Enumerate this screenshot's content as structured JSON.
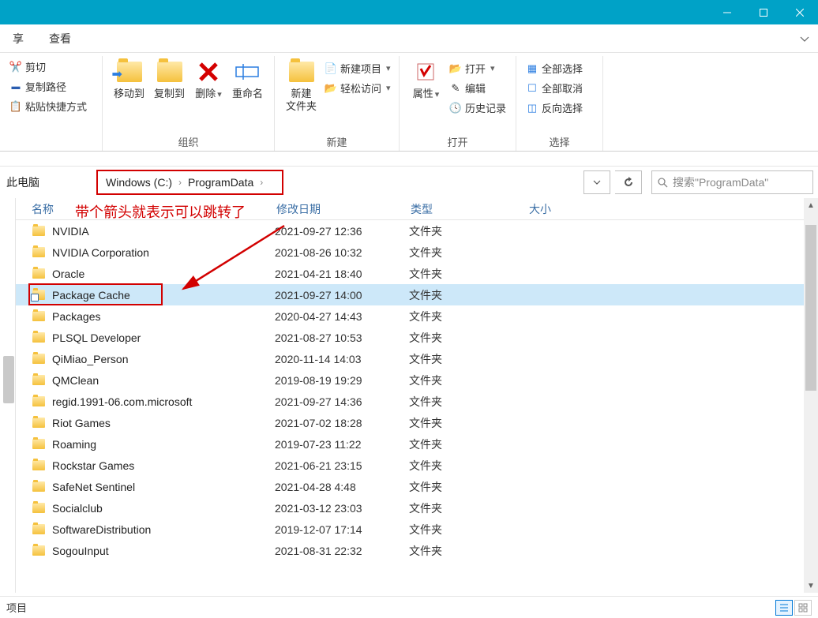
{
  "tabs": {
    "share": "享",
    "view": "查看"
  },
  "ribbon": {
    "clipboard": {
      "cut": "剪切",
      "copypath": "复制路径",
      "pasteshortcut": "粘贴快捷方式"
    },
    "organize": {
      "moveto": "移动到",
      "copyto": "复制到",
      "delete": "删除",
      "rename": "重命名",
      "label": "组织"
    },
    "new": {
      "newfolder": "新建",
      "newfolder2": "文件夹",
      "newitem": "新建项目",
      "easyaccess": "轻松访问",
      "label": "新建"
    },
    "open": {
      "properties": "属性",
      "open": "打开",
      "edit": "编辑",
      "history": "历史记录",
      "label": "打开"
    },
    "select": {
      "all": "全部选择",
      "none": "全部取消",
      "invert": "反向选择",
      "label": "选择"
    }
  },
  "breadcrumb": {
    "root": "此电脑",
    "drive": "Windows (C:)",
    "folder": "ProgramData"
  },
  "search": {
    "placeholder": "搜索\"ProgramData\""
  },
  "columns": {
    "name": "名称",
    "date": "修改日期",
    "type": "类型",
    "size": "大小"
  },
  "annotation": "带个箭头就表示可以跳转了",
  "type_folder": "文件夹",
  "files": [
    {
      "name": "NVIDIA",
      "date": "2021-09-27 12:36",
      "shortcut": false
    },
    {
      "name": "NVIDIA Corporation",
      "date": "2021-08-26 10:32",
      "shortcut": false
    },
    {
      "name": "Oracle",
      "date": "2021-04-21 18:40",
      "shortcut": false
    },
    {
      "name": "Package Cache",
      "date": "2021-09-27 14:00",
      "shortcut": true,
      "selected": true
    },
    {
      "name": "Packages",
      "date": "2020-04-27 14:43",
      "shortcut": false
    },
    {
      "name": "PLSQL Developer",
      "date": "2021-08-27 10:53",
      "shortcut": false
    },
    {
      "name": "QiMiao_Person",
      "date": "2020-11-14 14:03",
      "shortcut": false
    },
    {
      "name": "QMClean",
      "date": "2019-08-19 19:29",
      "shortcut": false
    },
    {
      "name": "regid.1991-06.com.microsoft",
      "date": "2021-09-27 14:36",
      "shortcut": false
    },
    {
      "name": "Riot Games",
      "date": "2021-07-02 18:28",
      "shortcut": false
    },
    {
      "name": "Roaming",
      "date": "2019-07-23 11:22",
      "shortcut": false
    },
    {
      "name": "Rockstar Games",
      "date": "2021-06-21 23:15",
      "shortcut": false
    },
    {
      "name": "SafeNet Sentinel",
      "date": "2021-04-28 4:48",
      "shortcut": false
    },
    {
      "name": "Socialclub",
      "date": "2021-03-12 23:03",
      "shortcut": false
    },
    {
      "name": "SoftwareDistribution",
      "date": "2019-12-07 17:14",
      "shortcut": false
    },
    {
      "name": "SogouInput",
      "date": "2021-08-31 22:32",
      "shortcut": false
    }
  ],
  "status": {
    "label": "项目"
  }
}
